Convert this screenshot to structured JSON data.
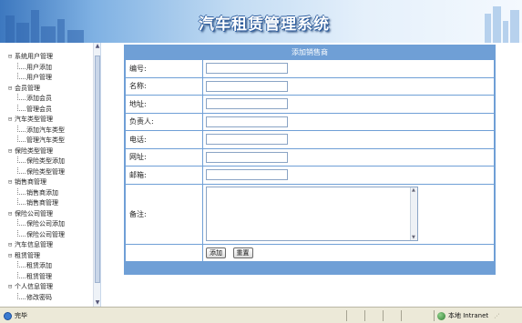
{
  "app": {
    "title": "汽车租赁管理系统"
  },
  "nav": {
    "groups": [
      {
        "label": "系统用户管理",
        "items": [
          "用户添加",
          "用户管理"
        ]
      },
      {
        "label": "会员管理",
        "items": [
          "添加会员",
          "管理会员"
        ]
      },
      {
        "label": "汽车类型管理",
        "items": [
          "添加汽车类型",
          "管理汽车类型"
        ]
      },
      {
        "label": "保险类型管理",
        "items": [
          "保险类型添加",
          "保险类型管理"
        ]
      },
      {
        "label": "销售商管理",
        "items": [
          "销售商添加",
          "销售商管理"
        ]
      },
      {
        "label": "保险公司管理",
        "items": [
          "保险公司添加",
          "保险公司管理"
        ]
      },
      {
        "label": "汽车信息管理",
        "items": []
      },
      {
        "label": "租赁管理",
        "items": [
          "租赁添加",
          "租赁管理"
        ]
      },
      {
        "label": "个人信息管理",
        "items": [
          "修改密码"
        ]
      }
    ]
  },
  "form": {
    "caption": "添加销售商",
    "fields": {
      "code": {
        "label": "编号:",
        "value": ""
      },
      "name": {
        "label": "名称:",
        "value": ""
      },
      "address": {
        "label": "地址:",
        "value": ""
      },
      "contact": {
        "label": "负责人:",
        "value": ""
      },
      "phone": {
        "label": "电话:",
        "value": ""
      },
      "website": {
        "label": "网址:",
        "value": ""
      },
      "postcode": {
        "label": "邮箱:",
        "value": ""
      },
      "remark": {
        "label": "备注:",
        "value": ""
      }
    },
    "buttons": {
      "submit": "添加",
      "reset": "重置"
    }
  },
  "statusbar": {
    "left": "完毕",
    "zone": "本地 Intranet"
  },
  "colors": {
    "accent": "#6f9fd6",
    "banner_dark": "#3d78bf",
    "status_bg": "#ece9d8"
  }
}
